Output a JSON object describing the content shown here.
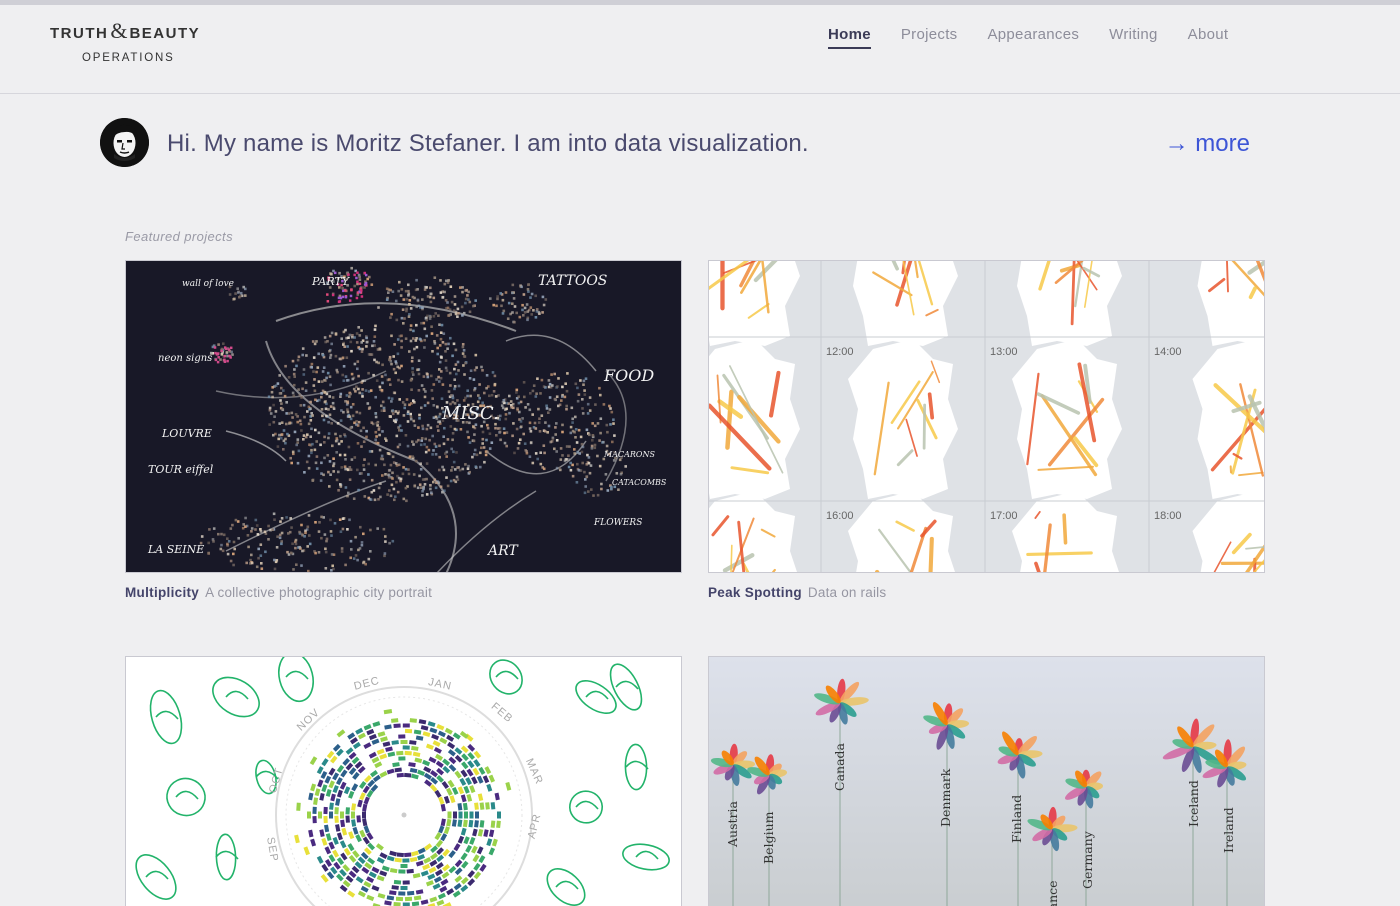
{
  "logo": {
    "line1_a": "TRUTH",
    "amp": "&",
    "line1_b": "BEAUTY",
    "line2": "OPERATIONS"
  },
  "nav": [
    {
      "label": "Home",
      "active": true
    },
    {
      "label": "Projects",
      "active": false
    },
    {
      "label": "Appearances",
      "active": false
    },
    {
      "label": "Writing",
      "active": false
    },
    {
      "label": "About",
      "active": false
    }
  ],
  "intro": {
    "text": "Hi. My name is Moritz Stefaner. I am into data visualization.",
    "more": "→ more"
  },
  "featured": {
    "label": "Featured projects",
    "projects": [
      {
        "title": "Multiplicity",
        "subtitle": "A collective photographic city portrait"
      },
      {
        "title": "Peak Spotting",
        "subtitle": "Data on rails"
      },
      {
        "title": "",
        "subtitle": ""
      },
      {
        "title": "",
        "subtitle": ""
      }
    ]
  },
  "multiplicity_labels": [
    "wall of love",
    "PARTY",
    "TATTOOS",
    "neon signs",
    "FOOD",
    "MISC.",
    "LOUVRE",
    "TOUR eiffel",
    "MACARONS",
    "CATACOMBS",
    "FLOWERS",
    "LA SEINE",
    "ART"
  ],
  "peak_times": [
    "12:00",
    "13:00",
    "14:00",
    "16:00",
    "17:00",
    "18:00"
  ],
  "months": [
    "DEC",
    "JAN",
    "FEB",
    "MAR",
    "APR",
    "NOV",
    "OCT",
    "SEP"
  ],
  "countries": [
    "Austria",
    "Belgium",
    "Canada",
    "Denmark",
    "Finland",
    "France",
    "Germany",
    "Iceland",
    "Ireland"
  ],
  "colors": {
    "accent": "#3d55d6",
    "nav_active": "#3b3b57",
    "background": "#efeff1"
  }
}
